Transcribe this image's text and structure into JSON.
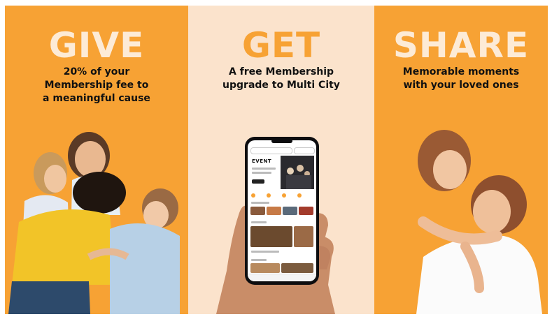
{
  "panels": [
    {
      "title": "GIVE",
      "lines": [
        "20% of your",
        "Membership fee to",
        "a meaningful cause"
      ]
    },
    {
      "title": "GET",
      "lines": [
        "A free Membership",
        "upgrade to Multi City"
      ]
    },
    {
      "title": "SHARE",
      "lines": [
        "Memorable moments",
        "with your loved ones"
      ]
    }
  ],
  "phone_app": {
    "brand": "EVENT"
  },
  "colors": {
    "accent_orange": "#F7A234",
    "cream": "#FBE3CC",
    "title_light": "#FDEBD6"
  }
}
